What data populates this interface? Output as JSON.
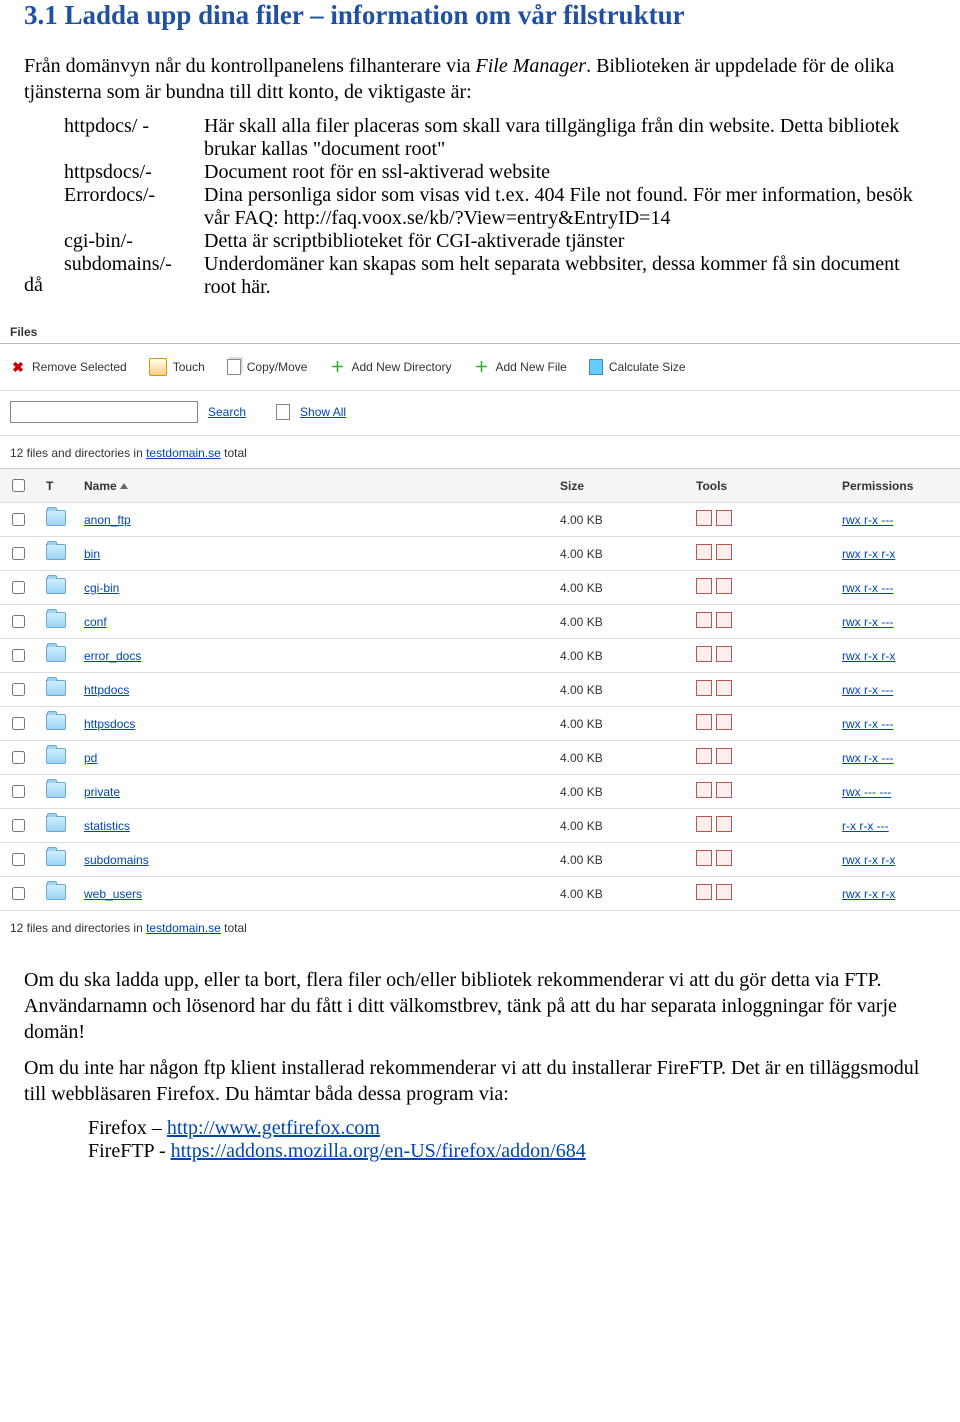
{
  "heading": "3.1 Ladda upp dina filer – information om vår filstruktur",
  "intro1_a": "Från domänvyn når du kontrollpanelens filhanterare via ",
  "intro1_b": "File Manager",
  "intro1_c": ". Biblioteken är uppdelade för de olika tjänsterna som är bundna till ditt konto, de viktigaste är:",
  "da_label": "då",
  "definitions": [
    {
      "key": "httpdocs/ -",
      "val": "Här skall alla filer placeras som skall vara tillgängliga från din website. Detta bibliotek brukar kallas \"document root\""
    },
    {
      "key": "httpsdocs/-",
      "val": "Document root för en ssl-aktiverad website"
    },
    {
      "key": "Errordocs/-",
      "val": "Dina personliga sidor som visas vid t.ex. 404 File not found. För mer information, besök vår FAQ: http://faq.voox.se/kb/?View=entry&EntryID=14"
    },
    {
      "key": "cgi-bin/-",
      "val": "Detta är scriptbiblioteket för CGI-aktiverade tjänster"
    },
    {
      "key": "subdomains/-",
      "val": "Underdomäner kan skapas som helt separata webbsiter, dessa kommer få sin document root här."
    }
  ],
  "panel": {
    "title": "Files",
    "toolbar": {
      "remove": "Remove Selected",
      "touch": "Touch",
      "copy": "Copy/Move",
      "adddir": "Add New Directory",
      "addfile": "Add New File",
      "calc": "Calculate Size"
    },
    "search": {
      "placeholder": "",
      "search_label": "Search",
      "showall_label": "Show All"
    },
    "count_prefix": "12 files and directories in ",
    "count_link": "testdomain.se",
    "count_suffix": " total",
    "headers": {
      "t": "T",
      "name": "Name",
      "size": "Size",
      "tools": "Tools",
      "perm": "Permissions"
    },
    "rows": [
      {
        "name": "anon_ftp",
        "size": "4.00 KB",
        "perm": "rwx r-x ---"
      },
      {
        "name": "bin",
        "size": "4.00 KB",
        "perm": "rwx r-x r-x"
      },
      {
        "name": "cgi-bin",
        "size": "4.00 KB",
        "perm": "rwx r-x ---"
      },
      {
        "name": "conf",
        "size": "4.00 KB",
        "perm": "rwx r-x ---"
      },
      {
        "name": "error_docs",
        "size": "4.00 KB",
        "perm": "rwx r-x r-x"
      },
      {
        "name": "httpdocs",
        "size": "4.00 KB",
        "perm": "rwx r-x ---"
      },
      {
        "name": "httpsdocs",
        "size": "4.00 KB",
        "perm": "rwx r-x ---"
      },
      {
        "name": "pd",
        "size": "4.00 KB",
        "perm": "rwx r-x ---"
      },
      {
        "name": "private",
        "size": "4.00 KB",
        "perm": "rwx --- ---"
      },
      {
        "name": "statistics",
        "size": "4.00 KB",
        "perm": "r-x r-x ---"
      },
      {
        "name": "subdomains",
        "size": "4.00 KB",
        "perm": "rwx r-x r-x"
      },
      {
        "name": "web_users",
        "size": "4.00 KB",
        "perm": "rwx r-x r-x"
      }
    ]
  },
  "para2": "Om du ska ladda upp, eller ta bort, flera filer och/eller bibliotek rekommenderar vi att du gör detta via FTP. Användarnamn och lösenord har du fått i ditt välkomstbrev, tänk på att du har separata inloggningar för varje domän!",
  "para3": "Om du inte har någon ftp klient installerad rekommenderar vi att du installerar FireFTP. Det är en tilläggsmodul till webbläsaren Firefox. Du hämtar båda dessa program via:",
  "dl1_label": "Firefox – ",
  "dl1_link": "http://www.getfirefox.com",
  "dl2_label": "FireFTP - ",
  "dl2_link": "https://addons.mozilla.org/en-US/firefox/addon/684"
}
